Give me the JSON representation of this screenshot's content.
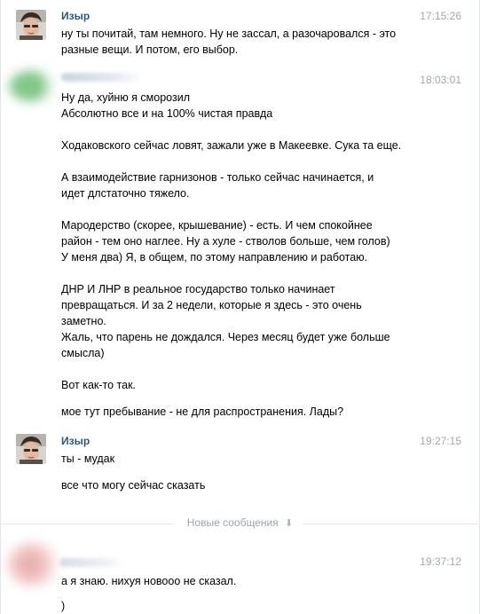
{
  "messages": [
    {
      "sender": "Изыр",
      "time": "17:15:26",
      "lines": [
        "ну ты почитай, там немного. Ну не зассал, а разочаровался - это",
        "разные вещи. И потом, его выбор."
      ]
    },
    {
      "sender": "",
      "time": "18:03:01",
      "lines": [
        "Ну да, хуйню я сморозил",
        "Абсолютно все и на 100% чистая правда",
        "Ходаковского сейчас ловят, зажали уже в Макеевке. Сука та еще.",
        "А взаимодействие гарнизонов - только сейчас начинается, и",
        "идет длстаточно тяжело.",
        "Мародерство (скорее, крышевание) - есть. И чем спокойнее",
        "район - тем оно наглее. Ну а хуле - стволов больше, чем голов)",
        "У меня два) Я, в общем, по этому направлению и работаю.",
        "ДНР И ЛНР в реальное государство только начинает",
        "превращаться. И за 2 недели, которые я здесь - это очень",
        "заметно.",
        "Жаль, что парень не дождался. Через месяц будет уже больше",
        "смысла)",
        "Вот как-то так.",
        "мое тут пребывание - не для распространения. Лады?"
      ]
    },
    {
      "sender": "Изыр",
      "time": "19:27:15",
      "lines": [
        "ты - мудак",
        "все что могу сейчас сказать"
      ]
    },
    {
      "sender": "",
      "time": "19:37:12",
      "lines": [
        "а я знаю. нихуя новооо не сказал.",
        ")"
      ]
    }
  ],
  "divider": {
    "label": "Новые сообщения",
    "icon": "arrow-down-icon"
  }
}
